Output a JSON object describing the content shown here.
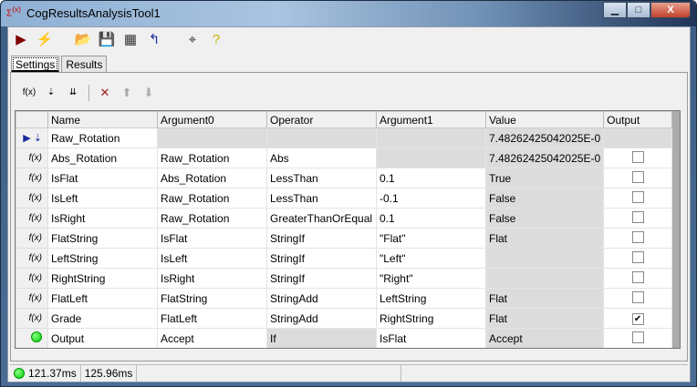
{
  "window": {
    "title": "CogResultsAnalysisTool1",
    "minimize": "▁",
    "maximize": "□",
    "close": "X"
  },
  "toolbar": [
    {
      "icon": "run-icon",
      "glyph": "▶",
      "color": "#800000"
    },
    {
      "icon": "lightning-icon",
      "glyph": "⚡",
      "color": "#c8b400"
    },
    {
      "icon": "open-folder-icon",
      "glyph": "📂",
      "color": "#b08000"
    },
    {
      "icon": "save-icon",
      "glyph": "💾",
      "color": "#333"
    },
    {
      "icon": "save-as-icon",
      "glyph": "▦",
      "color": "#333"
    },
    {
      "icon": "reset-icon",
      "glyph": "↰",
      "color": "#1a2ea0"
    },
    {
      "icon": "pointer-icon",
      "glyph": "⌖",
      "color": "#333"
    },
    {
      "icon": "help-icon",
      "glyph": "?",
      "color": "#c8b400"
    }
  ],
  "tabs": [
    {
      "label": "Settings",
      "active": true
    },
    {
      "label": "Results",
      "active": false
    }
  ],
  "inner_toolbar": [
    {
      "icon": "add-expression-icon",
      "glyph": "f(x)"
    },
    {
      "icon": "add-input-icon",
      "glyph": "⇣"
    },
    {
      "icon": "add-inputs-icon",
      "glyph": "⇊"
    },
    {
      "icon": "delete-icon",
      "glyph": "✕",
      "color": "#9b1c1c"
    },
    {
      "icon": "move-up-icon",
      "glyph": "⬆",
      "color": "#aaa"
    },
    {
      "icon": "move-down-icon",
      "glyph": "⬇",
      "color": "#aaa"
    }
  ],
  "grid": {
    "columns": [
      "Name",
      "Argument0",
      "Operator",
      "Argument1",
      "Value",
      "Output"
    ],
    "rows": [
      {
        "type": "input",
        "name": "Raw_Rotation",
        "arg0": "",
        "op": "",
        "arg1": "",
        "value": "7.48262425042025E-0",
        "output": null,
        "gray": [
          "arg0",
          "op",
          "arg1",
          "value",
          "output"
        ],
        "current": true
      },
      {
        "type": "expr",
        "name": "Abs_Rotation",
        "arg0": "Raw_Rotation",
        "op": "Abs",
        "arg1": "",
        "value": "7.48262425042025E-0",
        "output": false,
        "gray": [
          "arg1",
          "value"
        ]
      },
      {
        "type": "expr",
        "name": "IsFlat",
        "arg0": "Abs_Rotation",
        "op": "LessThan",
        "arg1": "0.1",
        "value": "True",
        "output": false,
        "gray": [
          "value"
        ]
      },
      {
        "type": "expr",
        "name": "IsLeft",
        "arg0": "Raw_Rotation",
        "op": "LessThan",
        "arg1": "-0.1",
        "value": "False",
        "output": false,
        "gray": [
          "value"
        ]
      },
      {
        "type": "expr",
        "name": "IsRight",
        "arg0": "Raw_Rotation",
        "op": "GreaterThanOrEqual",
        "arg1": "0.1",
        "value": "False",
        "output": false,
        "gray": [
          "value"
        ]
      },
      {
        "type": "expr",
        "name": "FlatString",
        "arg0": "IsFlat",
        "op": "StringIf",
        "arg1": "\"Flat\"",
        "value": "Flat",
        "output": false,
        "gray": [
          "value"
        ]
      },
      {
        "type": "expr",
        "name": "LeftString",
        "arg0": "IsLeft",
        "op": "StringIf",
        "arg1": "\"Left\"",
        "value": "",
        "output": false,
        "gray": [
          "value"
        ]
      },
      {
        "type": "expr",
        "name": "RightString",
        "arg0": "IsRight",
        "op": "StringIf",
        "arg1": "\"Right\"",
        "value": "",
        "output": false,
        "gray": [
          "value"
        ]
      },
      {
        "type": "expr",
        "name": "FlatLeft",
        "arg0": "FlatString",
        "op": "StringAdd",
        "arg1": "LeftString",
        "value": "Flat",
        "output": false,
        "gray": [
          "value"
        ]
      },
      {
        "type": "expr",
        "name": "Grade",
        "arg0": "FlatLeft",
        "op": "StringAdd",
        "arg1": "RightString",
        "value": "Flat",
        "output": true,
        "gray": [
          "value"
        ]
      },
      {
        "type": "output",
        "name": "Output",
        "arg0": "Accept",
        "op": "If",
        "arg1": "IsFlat",
        "value": "Accept",
        "output": false,
        "gray": [
          "op",
          "value"
        ]
      }
    ]
  },
  "status": {
    "indicator_color": "#00cc00",
    "time1": "121.37ms",
    "time2": "125.96ms"
  }
}
